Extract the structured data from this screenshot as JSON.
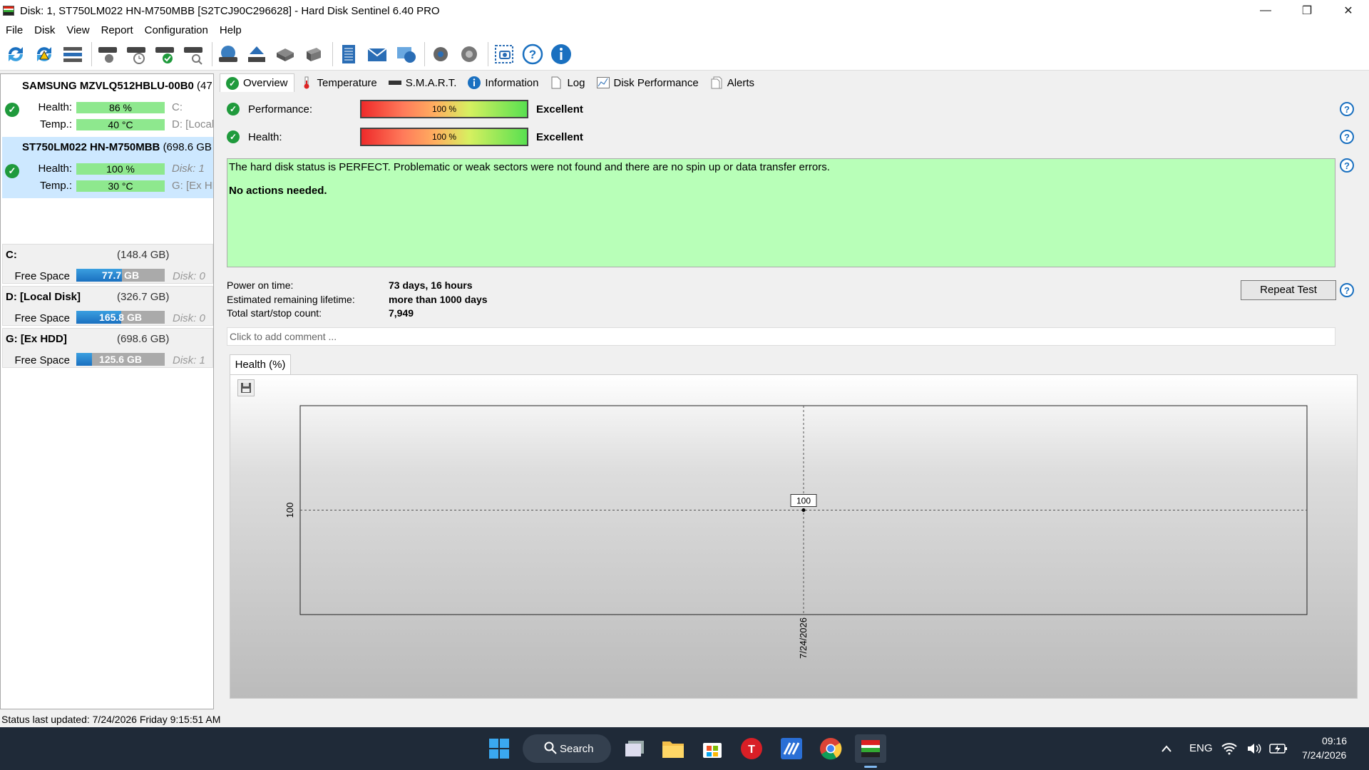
{
  "window": {
    "title": "Disk: 1, ST750LM022 HN-M750MBB [S2TCJ90C296628]  -  Hard Disk Sentinel 6.40 PRO",
    "minimize": "—",
    "restore": "❐",
    "close": "✕"
  },
  "menu": [
    "File",
    "Disk",
    "View",
    "Report",
    "Configuration",
    "Help"
  ],
  "toolbar": {
    "icons": [
      "refresh-icon",
      "refresh-warning-icon",
      "disk-list-icon",
      "disk-search-icon",
      "disk-schedule-icon",
      "disk-ok-icon",
      "disk-zoom-icon",
      "disk-globe-icon",
      "eject-icon",
      "network-disk-icon",
      "disk-drive-icon",
      "report-icon",
      "mail-icon",
      "web-icon",
      "settings-icon",
      "sound-icon",
      "screenshot-icon",
      "help-icon",
      "info-icon"
    ]
  },
  "disks": [
    {
      "name": "SAMSUNG MZVLQ512HBLU-00B0",
      "size": "(47",
      "health_label": "Health:",
      "health": "86 %",
      "health_value": 86,
      "temp_label": "Temp.:",
      "temp": "40 °C",
      "part1": "C:",
      "part2": "D: [Local",
      "selected": false
    },
    {
      "name": "ST750LM022 HN-M750MBB",
      "size": "(698.6 GB",
      "health_label": "Health:",
      "health": "100 %",
      "health_value": 100,
      "temp_label": "Temp.:",
      "temp": "30 °C",
      "part1": "Disk: 1",
      "part2": "G: [Ex HD",
      "selected": true
    }
  ],
  "volumes": [
    {
      "name": "C:",
      "size": "(148.4 GB)",
      "free_label": "Free Space",
      "free": "77.7 GB",
      "free_fraction": 0.52,
      "disk": "Disk: 0"
    },
    {
      "name": "D: [Local Disk]",
      "size": "(326.7 GB)",
      "free_label": "Free Space",
      "free": "165.8 GB",
      "free_fraction": 0.51,
      "disk": "Disk: 0"
    },
    {
      "name": "G: [Ex HDD]",
      "size": "(698.6 GB)",
      "free_label": "Free Space",
      "free": "125.6 GB",
      "free_fraction": 0.18,
      "disk": "Disk: 1"
    }
  ],
  "tabs": [
    {
      "label": "Overview",
      "icon": "check-icon",
      "active": true
    },
    {
      "label": "Temperature",
      "icon": "thermometer-icon",
      "active": false
    },
    {
      "label": "S.M.A.R.T.",
      "icon": "smart-icon",
      "active": false
    },
    {
      "label": "Information",
      "icon": "info-icon",
      "active": false
    },
    {
      "label": "Log",
      "icon": "log-icon",
      "active": false
    },
    {
      "label": "Disk Performance",
      "icon": "chart-icon",
      "active": false
    },
    {
      "label": "Alerts",
      "icon": "alerts-icon",
      "active": false
    }
  ],
  "overview": {
    "performance_label": "Performance:",
    "performance": "100 %",
    "performance_rating": "Excellent",
    "health_label": "Health:",
    "health": "100 %",
    "health_rating": "Excellent",
    "status_text": "The hard disk status is PERFECT. Problematic or weak sectors were not found and there are no spin up or data transfer errors.",
    "action_text": "No actions needed.",
    "power_on_label": "Power on time:",
    "power_on": "73 days, 16 hours",
    "lifetime_label": "Estimated remaining lifetime:",
    "lifetime": "more than 1000 days",
    "startstop_label": "Total start/stop count:",
    "startstop": "7,949",
    "repeat_test": "Repeat Test",
    "comment_placeholder": "Click to add comment ...",
    "help": "?"
  },
  "chart_tab": "Health (%)",
  "chart_data": {
    "type": "line",
    "x": [
      "7/24/2026"
    ],
    "series": [
      {
        "values": [
          100
        ]
      }
    ],
    "point_labels": [
      "100"
    ],
    "ytick": "100",
    "xtick": "7/24/2026",
    "grid": true
  },
  "statusbar": "Status last updated: 7/24/2026 Friday 9:15:51 AM",
  "taskbar": {
    "search": "Search",
    "lang": "ENG",
    "time": "09:16",
    "date": "7/24/2026"
  }
}
